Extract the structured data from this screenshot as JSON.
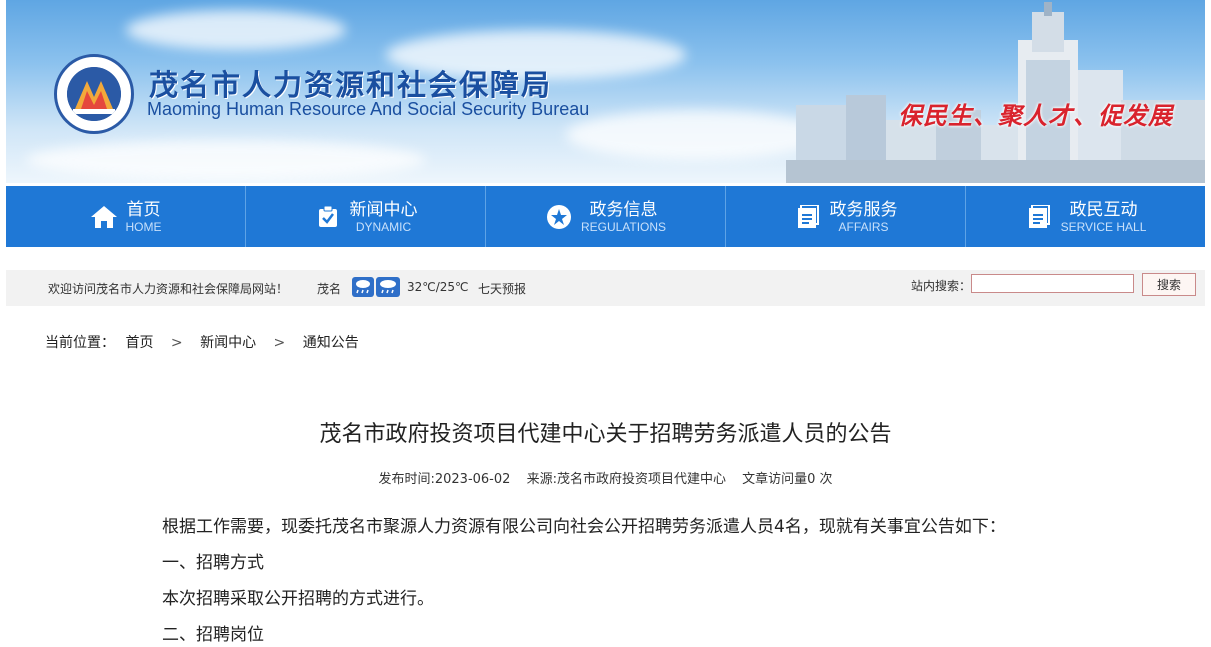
{
  "site": {
    "title_cn": "茂名市人力资源和社会保障局",
    "title_en": "Maoming Human Resource And Social Security Bureau",
    "slogan": "保民生、聚人才、促发展"
  },
  "nav": [
    {
      "label": "首页",
      "sub": "HOME",
      "icon": "home-icon"
    },
    {
      "label": "新闻中心",
      "sub": "DYNAMIC",
      "icon": "clipboard-icon"
    },
    {
      "label": "政务信息",
      "sub": "REGULATIONS",
      "icon": "star-icon"
    },
    {
      "label": "政务服务",
      "sub": "AFFAIRS",
      "icon": "document-icon"
    },
    {
      "label": "政民互动",
      "sub": "SERVICE HALL",
      "icon": "document-icon"
    }
  ],
  "infobar": {
    "welcome": "欢迎访问茂名市人力资源和社会保障局网站！",
    "city": "茂名",
    "weather_icons": [
      "rain-icon",
      "rain-icon"
    ],
    "temperature": "32℃/25℃",
    "forecast_link": "七天预报",
    "search_label": "站内搜索：",
    "search_value": "",
    "search_button": "搜索"
  },
  "breadcrumb": {
    "label": "当前位置：",
    "items": [
      "首页",
      "新闻中心",
      "通知公告"
    ],
    "separator": ">"
  },
  "article": {
    "title": "茂名市政府投资项目代建中心关于招聘劳务派遣人员的公告",
    "publish_time": "发布时间:2023-06-02",
    "source": "来源:茂名市政府投资项目代建中心",
    "views": "文章访问量0 次",
    "paragraphs": [
      "根据工作需要，现委托茂名市聚源人力资源有限公司向社会公开招聘劳务派遣人员4名，现就有关事宜公告如下：",
      "一、招聘方式",
      "本次招聘采取公开招聘的方式进行。",
      "二、招聘岗位"
    ]
  }
}
